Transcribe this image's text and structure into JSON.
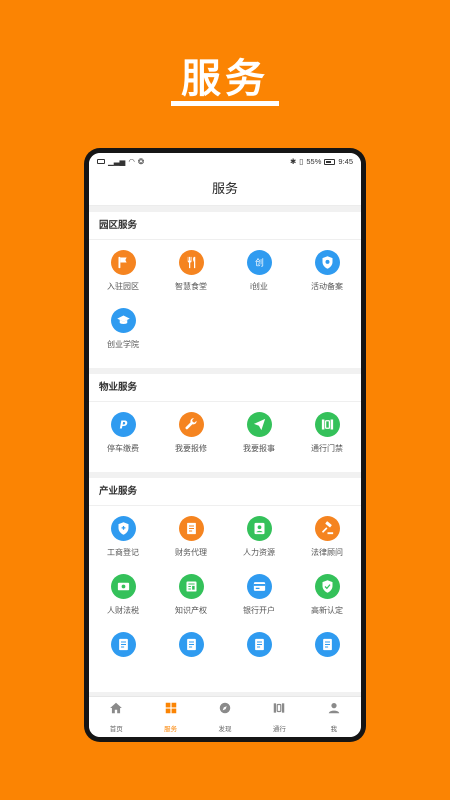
{
  "promo": {
    "title": "服务"
  },
  "statusbar": {
    "battery": "55%",
    "time": "9:45"
  },
  "header": {
    "title": "服务"
  },
  "colors": {
    "brand": "#fb8403",
    "orange": "#f58420",
    "blue": "#2f9bf0",
    "green": "#34c15a",
    "teal": "#26b8a8"
  },
  "sections": [
    {
      "title": "园区服务",
      "items": [
        {
          "label": "入驻园区",
          "icon": "flag-icon"
        },
        {
          "label": "智慧食堂",
          "icon": "utensils-icon"
        },
        {
          "label": "i创业",
          "icon": "chuang-icon"
        },
        {
          "label": "活动备案",
          "icon": "badge-icon"
        },
        {
          "label": "创业学院",
          "icon": "graduation-cap-icon"
        }
      ]
    },
    {
      "title": "物业服务",
      "items": [
        {
          "label": "停车缴费",
          "icon": "parking-icon"
        },
        {
          "label": "我要报修",
          "icon": "wrench-icon"
        },
        {
          "label": "我要报事",
          "icon": "send-icon"
        },
        {
          "label": "通行门禁",
          "icon": "gate-icon"
        }
      ]
    },
    {
      "title": "产业服务",
      "items": [
        {
          "label": "工商登记",
          "icon": "shield-icon"
        },
        {
          "label": "财务代理",
          "icon": "ledger-icon"
        },
        {
          "label": "人力资源",
          "icon": "person-icon"
        },
        {
          "label": "法律顾问",
          "icon": "gavel-icon"
        },
        {
          "label": "人财法税",
          "icon": "money-icon"
        },
        {
          "label": "知识产权",
          "icon": "newspaper-icon"
        },
        {
          "label": "银行开户",
          "icon": "bank-card-icon"
        },
        {
          "label": "高新认定",
          "icon": "check-shield-icon"
        },
        {
          "label": "",
          "icon": "document-icon"
        },
        {
          "label": "",
          "icon": "document-icon"
        },
        {
          "label": "",
          "icon": "document-icon"
        },
        {
          "label": "",
          "icon": "document-icon"
        }
      ]
    }
  ],
  "tabs": [
    {
      "label": "首页",
      "icon": "home-icon"
    },
    {
      "label": "服务",
      "icon": "grid-icon",
      "active": true
    },
    {
      "label": "发现",
      "icon": "compass-icon"
    },
    {
      "label": "通行",
      "icon": "gate-icon"
    },
    {
      "label": "我",
      "icon": "user-icon"
    }
  ]
}
